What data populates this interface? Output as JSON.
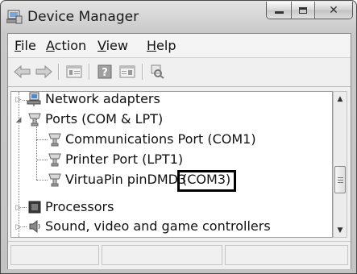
{
  "window": {
    "title": "Device Manager"
  },
  "menubar": {
    "items": [
      {
        "label": "File",
        "mnemonic": "F",
        "rest": "ile"
      },
      {
        "label": "Action",
        "mnemonic": "A",
        "rest": "ction"
      },
      {
        "label": "View",
        "mnemonic": "V",
        "rest": "iew"
      },
      {
        "label": "Help",
        "mnemonic": "H",
        "rest": "elp"
      }
    ]
  },
  "toolbar": {
    "buttons": [
      "back-arrow-icon",
      "forward-arrow-icon",
      "properties-icon",
      "help-icon",
      "update-driver-icon",
      "scan-hardware-icon"
    ]
  },
  "tree": {
    "nodes": [
      {
        "label": "Network adapters",
        "icon": "network-adapter-icon",
        "expanded": false
      },
      {
        "label": "Ports (COM & LPT)",
        "icon": "port-icon",
        "expanded": true
      },
      {
        "label": "Communications Port (COM1)",
        "icon": "port-icon",
        "child": true
      },
      {
        "label": "Printer Port (LPT1)",
        "icon": "port-icon",
        "child": true
      },
      {
        "label_main": "VirtuaPin pinDMD3",
        "label_port": "(COM3)",
        "icon": "port-icon",
        "child": true,
        "highlighted": true
      },
      {
        "label": "Processors",
        "icon": "processor-icon",
        "expanded": false
      },
      {
        "label": "Sound, video and game controllers",
        "icon": "speaker-icon",
        "expanded": false
      }
    ]
  },
  "colors": {
    "frame": "#c4c4c4",
    "highlight_border": "#000000"
  }
}
